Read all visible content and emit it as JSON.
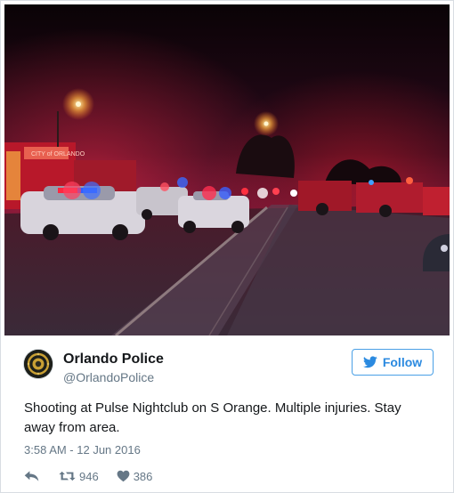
{
  "tweet": {
    "author": {
      "name": "Orlando Police",
      "handle": "@OrlandoPolice"
    },
    "follow_label": "Follow",
    "text": "Shooting at Pulse Nightclub on S Orange. Multiple injuries. Stay away from area.",
    "timestamp": "3:58 AM - 12 Jun 2016",
    "stats": {
      "retweets": "946",
      "likes": "386"
    },
    "photo": {
      "description_icon": "night-street-police-scene",
      "vehicle_sign_text": "CITY of ORLANDO"
    }
  },
  "colors": {
    "twitter_blue": "#2b8ae0",
    "text_primary": "#14171a",
    "text_secondary": "#657786"
  },
  "icons": {
    "follow": "bird-icon",
    "reply": "reply-icon",
    "retweet": "retweet-icon",
    "like": "heart-icon"
  }
}
